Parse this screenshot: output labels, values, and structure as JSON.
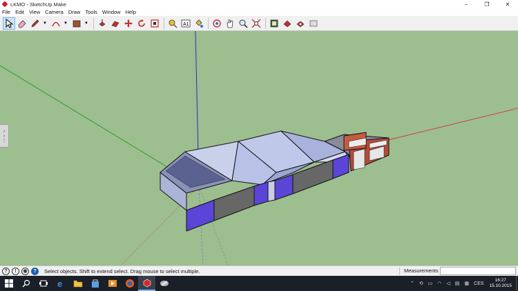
{
  "window": {
    "title": "LKMO - SketchUp Make",
    "minimize": "–",
    "maximize": "❐",
    "close": "✕"
  },
  "menu": [
    "File",
    "Edit",
    "View",
    "Camera",
    "Draw",
    "Tools",
    "Window",
    "Help"
  ],
  "toolbar": {
    "tools": [
      "select",
      "eraser",
      "line",
      "arc",
      "shapes",
      "push-pull",
      "move",
      "rotate",
      "offset",
      "tape-measure",
      "text",
      "paint-bucket",
      "orbit",
      "pan",
      "zoom",
      "zoom-extents",
      "3d-warehouse",
      "extension-warehouse",
      "layout",
      "style"
    ],
    "active": "select"
  },
  "colors": {
    "viewport_bg": "#9dbe8f",
    "axis_red": "#d04040",
    "axis_green": "#2e9a2e",
    "axis_blue": "#2a2ad0",
    "taskbar_bg": "#1b1f28"
  },
  "status": {
    "message": "Select objects. Shift to extend select. Drag mouse to select multiple.",
    "measurements_label": "Measurements",
    "measurements_value": ""
  },
  "taskbar": {
    "apps": [
      "windows-start",
      "search",
      "task-view",
      "edge",
      "file-explorer",
      "store",
      "media",
      "firefox",
      "sketchup",
      "other-app"
    ],
    "language": "CES",
    "time": "16:27",
    "date": "15.10.2015"
  }
}
